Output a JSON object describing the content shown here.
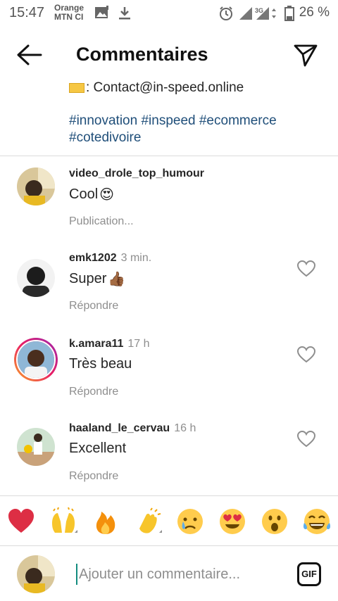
{
  "status_bar": {
    "time": "15:47",
    "carrier_line1": "Orange",
    "carrier_line2": "MTN CI",
    "network": "3G",
    "battery": "26 %",
    "icons": [
      "image-icon",
      "download-icon",
      "alarm-icon",
      "signal-icon",
      "battery-icon"
    ]
  },
  "header": {
    "title": "Commentaires",
    "back_icon": "arrow-left-icon",
    "send_icon": "paper-plane-icon"
  },
  "caption": {
    "contact": ": Contact@in-speed.online",
    "hashtags": "#innovation #inspeed #ecommerce #cotedivoire"
  },
  "comments": [
    {
      "username": "video_drole_top_humour",
      "time": "",
      "text": "Cool",
      "emoji": "😍",
      "action": "Publication..."
    },
    {
      "username": "emk1202",
      "time": "3 min.",
      "text": "Super",
      "emoji": "👍🏾",
      "action": "Répondre"
    },
    {
      "username": "k.amara11",
      "time": "17 h",
      "text": "Très beau",
      "emoji": "",
      "action": "Répondre"
    },
    {
      "username": "haaland_le_cervau",
      "time": "16 h",
      "text": "Excellent",
      "emoji": "",
      "action": "Répondre"
    }
  ],
  "quick_reactions": [
    "❤️",
    "🙌",
    "🔥",
    "👏",
    "😢",
    "😍",
    "😮",
    "😂"
  ],
  "input": {
    "placeholder": "Ajouter un commentaire...",
    "value": "",
    "gif_label": "GIF"
  },
  "colors": {
    "hashtag": "#1f4e79",
    "muted": "#8e8e8e",
    "divider": "#dbdbdb",
    "story_ring_start": "#f9a825",
    "story_ring_end": "#9c27b0"
  }
}
